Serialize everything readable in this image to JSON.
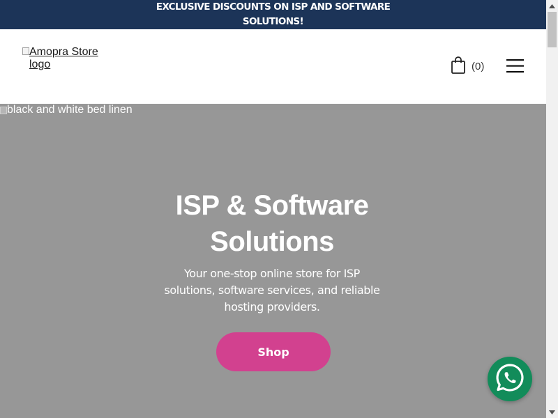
{
  "announcement": {
    "text": "EXCLUSIVE DISCOUNTS ON ISP AND SOFTWARE SOLUTIONS!"
  },
  "header": {
    "logo_alt": "Amopra Store logo",
    "cart_count": "(0)",
    "cart_icon": "shopping-bag-icon",
    "menu_icon": "hamburger-menu-icon"
  },
  "hero": {
    "image_alt": "black and white bed linen",
    "title": "ISP & Software Solutions",
    "subtitle": "Your one-stop online store for ISP solutions, software services, and reliable hosting providers.",
    "cta_label": "Shop"
  },
  "floating": {
    "whatsapp_icon": "whatsapp-icon"
  },
  "colors": {
    "announcement_bg": "#1c3458",
    "hero_bg": "#979797",
    "cta_bg": "#d2418f",
    "whatsapp_bg": "#128c5a"
  }
}
